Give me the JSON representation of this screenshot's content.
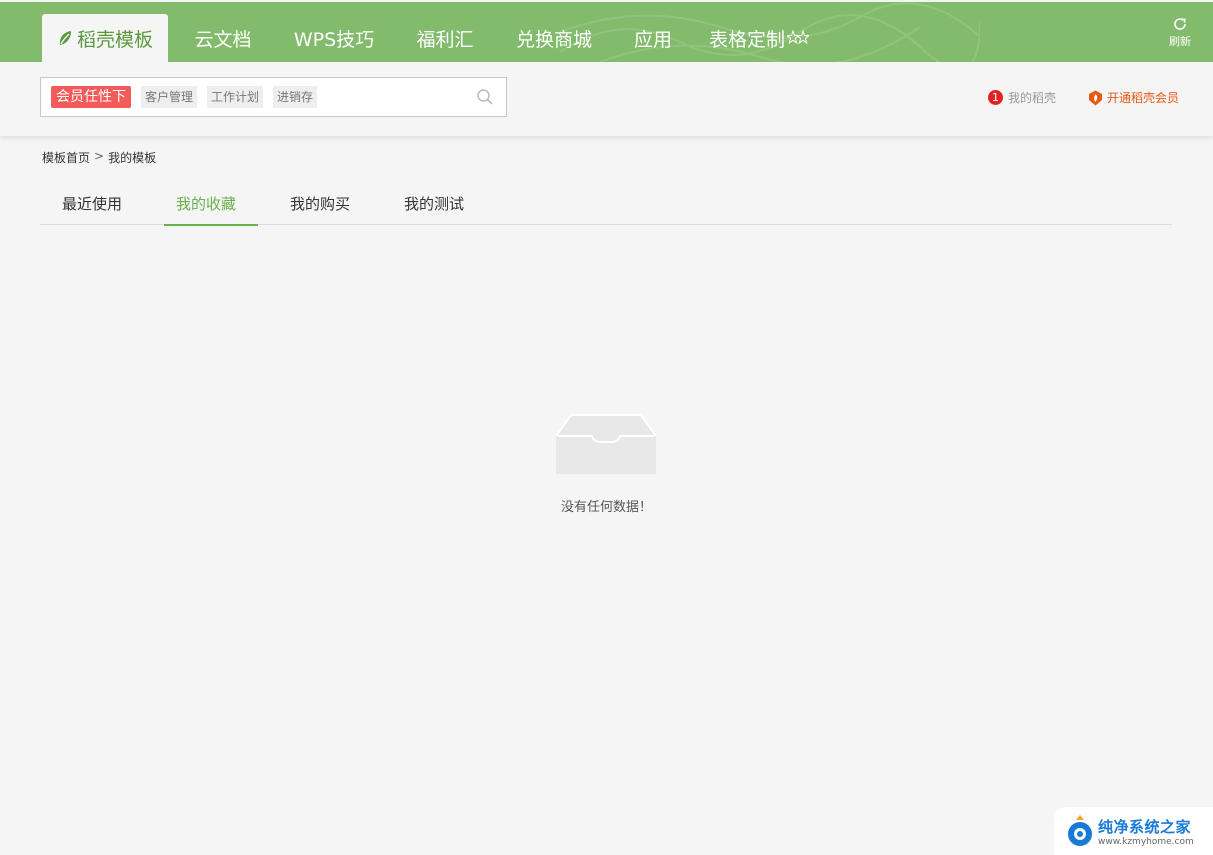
{
  "nav": {
    "tabs": [
      {
        "label": "稻壳模板",
        "active": true
      },
      {
        "label": "云文档"
      },
      {
        "label": "WPS技巧"
      },
      {
        "label": "福利汇"
      },
      {
        "label": "兑换商城"
      },
      {
        "label": "应用"
      },
      {
        "label": "表格定制"
      }
    ],
    "refresh_label": "刷新"
  },
  "search": {
    "hot_tag": "会员任性下",
    "tags": [
      "客户管理",
      "工作计划",
      "进销存"
    ],
    "placeholder": ""
  },
  "user": {
    "badge_count": "1",
    "my_shell": "我的稻壳",
    "vip_label": "开通稻壳会员"
  },
  "breadcrumb": {
    "home": "模板首页",
    "separator": ">",
    "current": "我的模板"
  },
  "subtabs": [
    {
      "label": "最近使用"
    },
    {
      "label": "我的收藏",
      "active": true
    },
    {
      "label": "我的购买"
    },
    {
      "label": "我的测试"
    }
  ],
  "empty": {
    "message": "没有任何数据！"
  },
  "watermark": {
    "title": "纯净系统之家",
    "url": "www.kzmyhome.com"
  },
  "colors": {
    "nav_green": "#82bb6c",
    "active_green": "#6ab04c",
    "hot_red": "#f25b59",
    "vip_orange": "#e85a11",
    "badge_red": "#e02323"
  },
  "icons": {
    "leaf": "leaf-icon",
    "star": "star-outline-icon",
    "refresh": "refresh-icon",
    "search": "search-icon",
    "vip": "flame-shield-icon",
    "empty": "empty-tray-icon"
  }
}
